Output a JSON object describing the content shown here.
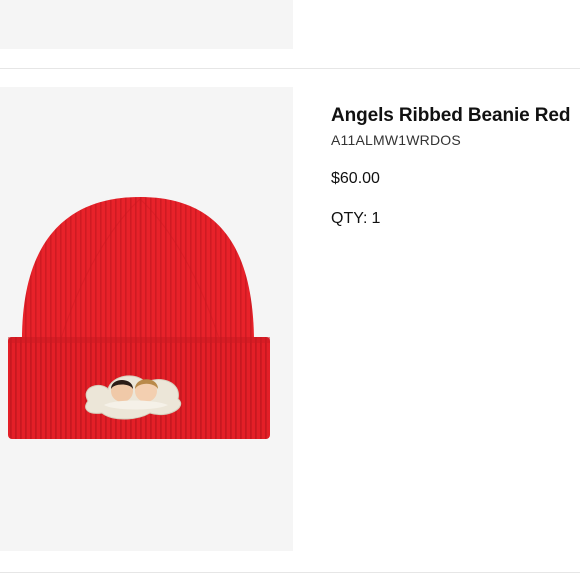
{
  "product": {
    "name": "Angels Ribbed Beanie Red",
    "sku": "A11ALMW1WRDOS",
    "price": "$60.00",
    "qty_label": "QTY:",
    "qty_value": "1",
    "image_alt": "Red ribbed beanie with angels patch"
  },
  "colors": {
    "beanie_red": "#e8222a",
    "image_background": "#f5f5f5"
  }
}
